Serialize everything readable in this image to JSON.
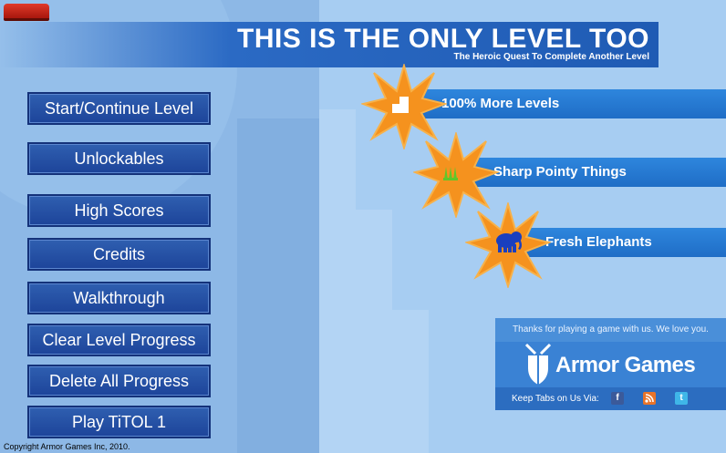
{
  "title": {
    "main": "THIS IS THE ONLY LEVEL TOO",
    "subtitle": "The Heroic Quest To Complete Another Level"
  },
  "menu": {
    "items": [
      {
        "label": "Start/Continue Level"
      },
      {
        "label": "Unlockables"
      },
      {
        "label": "High Scores"
      },
      {
        "label": "Credits"
      },
      {
        "label": "Walkthrough"
      },
      {
        "label": "Clear Level Progress"
      },
      {
        "label": "Delete All Progress"
      },
      {
        "label": "Play TiTOL 1"
      }
    ]
  },
  "features": {
    "items": [
      {
        "label": "100% More Levels",
        "icon": "block-icon"
      },
      {
        "label": "Sharp Pointy Things",
        "icon": "spikes-icon"
      },
      {
        "label": "Fresh Elephants",
        "icon": "elephant-icon"
      }
    ]
  },
  "sponsor": {
    "thanks": "Thanks for playing a game with us.  We love you.",
    "logo": "Armor Games",
    "tabs_label": "Keep Tabs on Us Via:",
    "social": [
      "facebook-icon",
      "rss-icon",
      "twitter-icon"
    ]
  },
  "footer": {
    "copyright": "Copyright Armor Games Inc, 2010."
  },
  "colors": {
    "button": "#2a57a8",
    "banner": "#2b6ac4",
    "feature_bar": "#2a7fd8",
    "star": "#f5921e",
    "background": "#9fc6ee"
  }
}
